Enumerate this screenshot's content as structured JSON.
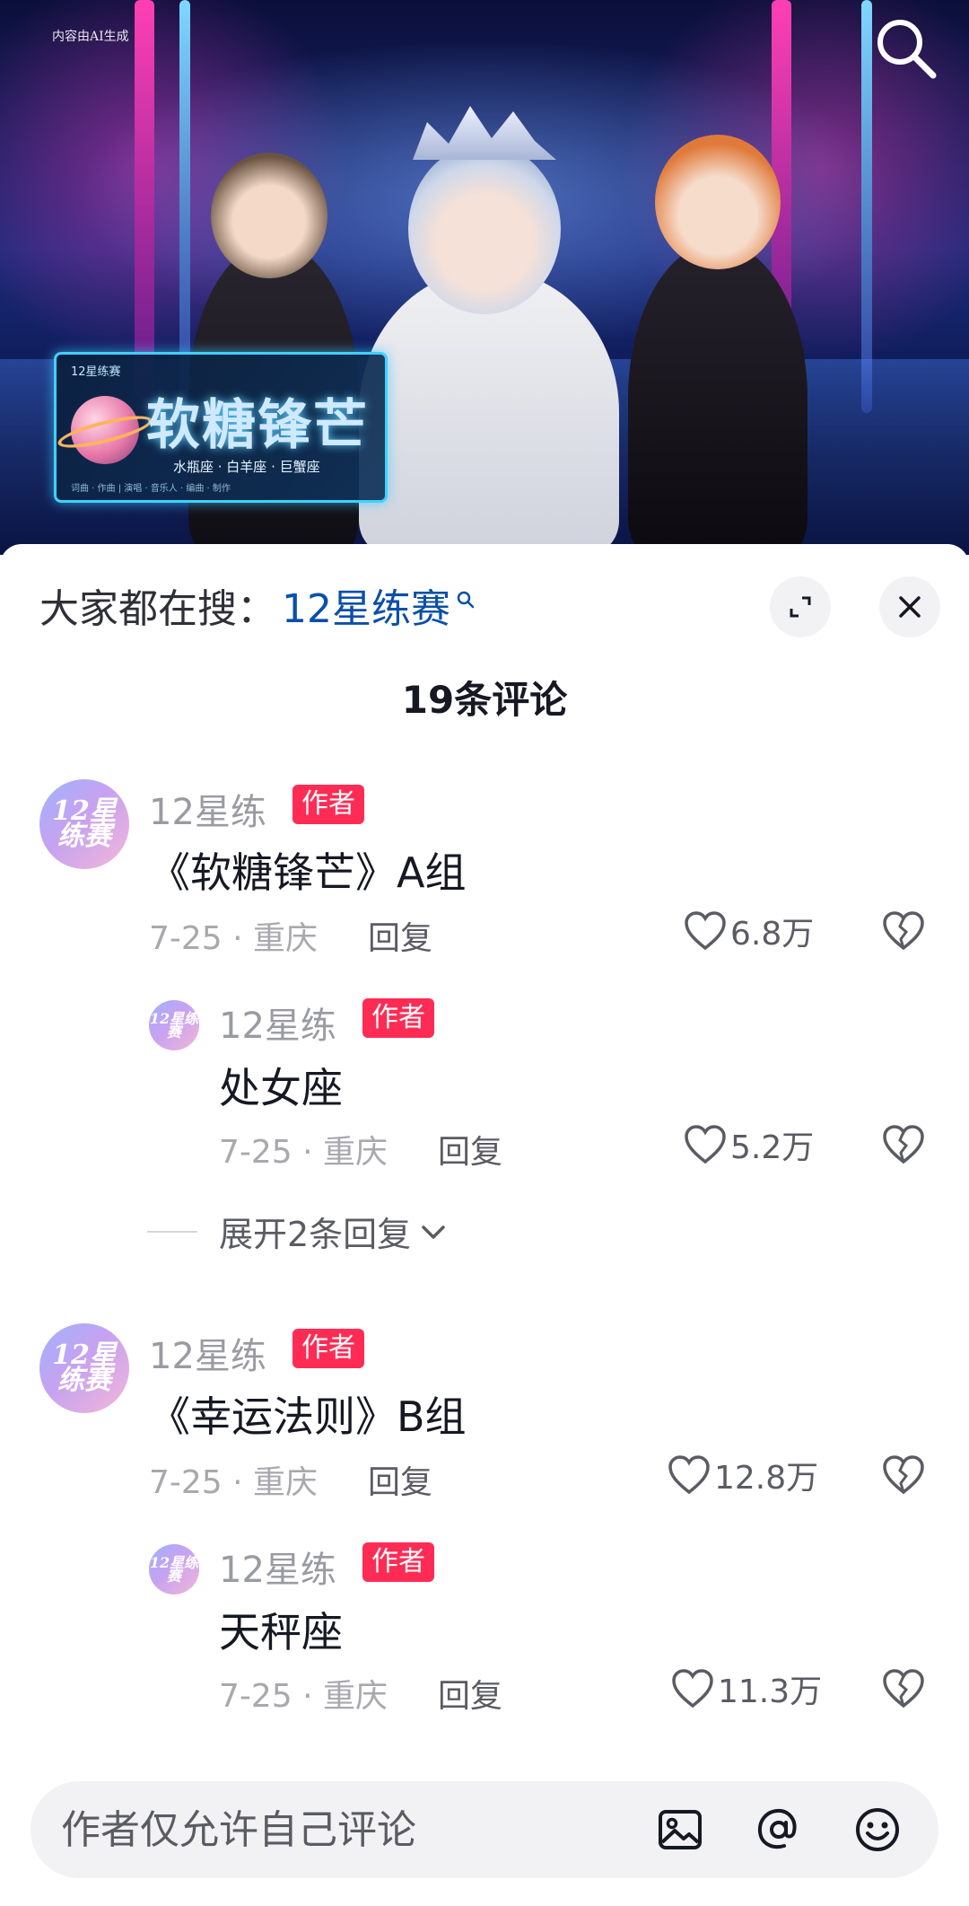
{
  "video": {
    "ai_tag": "内容由AI生成",
    "card": {
      "small_label": "12星练赛",
      "title": "软糖锋芒",
      "signs": "水瓶座 · 白羊座 · 巨蟹座",
      "credits": "词曲 · 作曲 | 演唱 · 音乐人 · 编曲 · 制作"
    }
  },
  "sheet": {
    "hot_search_prefix": "大家都在搜：",
    "hot_search_keyword": "12星练赛",
    "comment_count_title": "19条评论"
  },
  "comments": [
    {
      "author": "12星练",
      "badge": "作者",
      "avatar_text": "12星练赛",
      "text": "《软糖锋芒》A组",
      "date_location": "7-25 · 重庆",
      "reply": "回复",
      "likes": "6.8万",
      "replies": [
        {
          "author": "12星练",
          "badge": "作者",
          "avatar_text": "12星练赛",
          "text": "处女座",
          "date_location": "7-25 · 重庆",
          "reply": "回复",
          "likes": "5.2万"
        }
      ],
      "expand_label": "展开2条回复"
    },
    {
      "author": "12星练",
      "badge": "作者",
      "avatar_text": "12星练赛",
      "text": "《幸运法则》B组",
      "date_location": "7-25 · 重庆",
      "reply": "回复",
      "likes": "12.8万",
      "replies": [
        {
          "author": "12星练",
          "badge": "作者",
          "avatar_text": "12星练赛",
          "text": "天秤座",
          "date_location": "7-25 · 重庆",
          "reply": "回复",
          "likes": "11.3万"
        }
      ]
    }
  ],
  "input": {
    "placeholder": "作者仅允许自己评论"
  },
  "icons": {
    "search": "search-icon",
    "expand": "expand-icon",
    "close": "close-icon",
    "like": "heart-icon",
    "dislike": "broken-heart-icon",
    "image": "image-icon",
    "mention": "at-icon",
    "emoji": "emoji-icon"
  },
  "colors": {
    "badge": "#fe2c55",
    "keyword": "#0a4fa8"
  }
}
